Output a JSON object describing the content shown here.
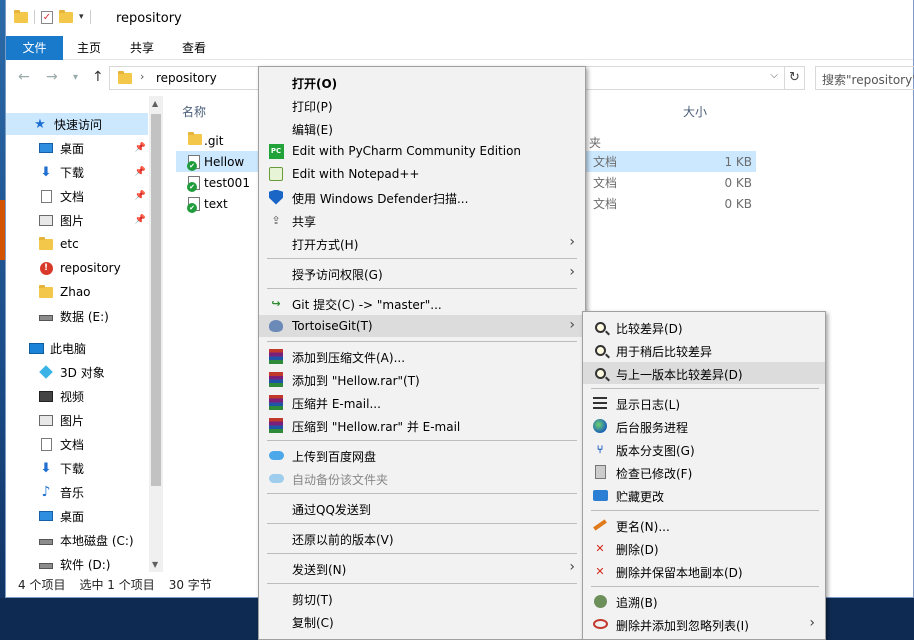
{
  "window": {
    "title": "repository"
  },
  "ribbon": {
    "tabs": [
      "文件",
      "主页",
      "共享",
      "查看"
    ]
  },
  "address": {
    "path": "repository",
    "search_placeholder": "搜索\"repository\""
  },
  "nav": {
    "items": [
      {
        "label": "快速访问",
        "icon": "star-icon"
      },
      {
        "label": "桌面",
        "icon": "desktop-icon"
      },
      {
        "label": "下载",
        "icon": "download-icon"
      },
      {
        "label": "文档",
        "icon": "document-icon"
      },
      {
        "label": "图片",
        "icon": "picture-icon"
      },
      {
        "label": "etc",
        "icon": "folder-icon"
      },
      {
        "label": "repository",
        "icon": "folder-warning-icon"
      },
      {
        "label": "Zhao",
        "icon": "folder-icon"
      },
      {
        "label": "数据 (E:)",
        "icon": "drive-icon"
      },
      {
        "label": "此电脑",
        "icon": "computer-icon"
      },
      {
        "label": "3D 对象",
        "icon": "3d-objects-icon"
      },
      {
        "label": "视频",
        "icon": "video-icon"
      },
      {
        "label": "图片",
        "icon": "picture-icon"
      },
      {
        "label": "文档",
        "icon": "document-icon"
      },
      {
        "label": "下载",
        "icon": "download-icon"
      },
      {
        "label": "音乐",
        "icon": "music-icon"
      },
      {
        "label": "桌面",
        "icon": "desktop-icon"
      },
      {
        "label": "本地磁盘 (C:)",
        "icon": "drive-icon"
      },
      {
        "label": "软件 (D:)",
        "icon": "drive-icon"
      }
    ]
  },
  "files": {
    "columns": {
      "name": "名称",
      "size": "大小",
      "type_partial": "夹"
    },
    "rows": [
      {
        "name": ".git",
        "type": "",
        "size": ""
      },
      {
        "name": "Hellow",
        "type": "文档",
        "size": "1 KB"
      },
      {
        "name": "test001",
        "type": "文档",
        "size": "0 KB"
      },
      {
        "name": "text",
        "type": "文档",
        "size": "0 KB"
      }
    ]
  },
  "status": {
    "count": "4 个项目",
    "selected": "选中 1 个项目",
    "bytes": "30 字节"
  },
  "context_menu": {
    "items": [
      "打开(O)",
      "打印(P)",
      "编辑(E)",
      "Edit with PyCharm Community Edition",
      "Edit with Notepad++",
      "使用 Windows Defender扫描...",
      "共享",
      "打开方式(H)",
      "授予访问权限(G)",
      "Git 提交(C) -> \"master\"...",
      "TortoiseGit(T)",
      "添加到压缩文件(A)...",
      "添加到 \"Hellow.rar\"(T)",
      "压缩并 E-mail...",
      "压缩到 \"Hellow.rar\" 并 E-mail",
      "上传到百度网盘",
      "自动备份该文件夹",
      "通过QQ发送到",
      "还原以前的版本(V)",
      "发送到(N)",
      "剪切(T)",
      "复制(C)"
    ]
  },
  "submenu": {
    "items": [
      "比较差异(D)",
      "用于稍后比较差异",
      "与上一版本比较差异(D)",
      "显示日志(L)",
      "后台服务进程",
      "版本分支图(G)",
      "检查已修改(F)",
      "贮藏更改",
      "更名(N)...",
      "删除(D)",
      "删除并保留本地副本(D)",
      "追溯(B)",
      "删除并添加到忽略列表(I)"
    ]
  }
}
